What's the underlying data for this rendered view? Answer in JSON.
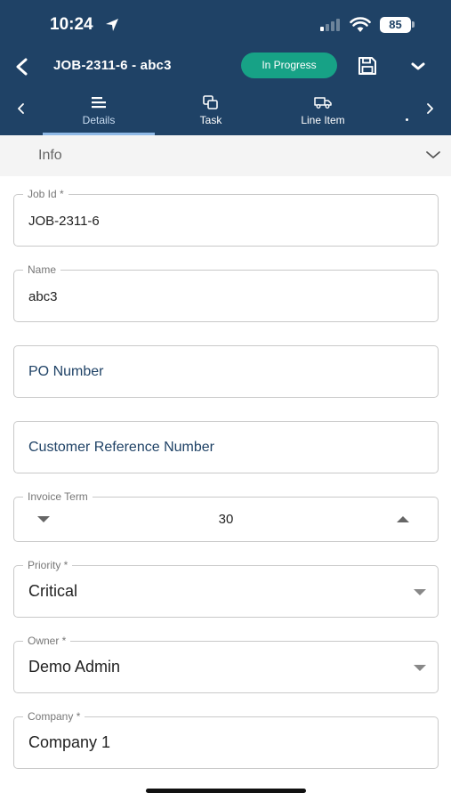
{
  "status_bar": {
    "time": "10:24",
    "battery": "85"
  },
  "header": {
    "job_title": "JOB-2311-6 - abc3",
    "status_badge": "In Progress",
    "status_color": "#17a286",
    "background_color": "#1f4266",
    "icons": {
      "back": "chevron-left-icon",
      "save": "floppy-disk-icon",
      "more": "chevron-down-icon"
    }
  },
  "tabs": [
    {
      "label": "Details",
      "icon": "lines-icon",
      "active": true
    },
    {
      "label": "Task",
      "icon": "copy-icon",
      "active": false
    },
    {
      "label": "Line Item",
      "icon": "truck-icon",
      "active": false
    }
  ],
  "section": {
    "title": "Info"
  },
  "fields": {
    "job_id": {
      "label": "Job Id *",
      "value": "JOB-2311-6"
    },
    "name": {
      "label": "Name",
      "value": "abc3"
    },
    "po_number": {
      "placeholder": "PO Number",
      "value": ""
    },
    "customer_reference": {
      "placeholder": "Customer Reference Number",
      "value": ""
    },
    "invoice_term": {
      "label": "Invoice Term",
      "value": "30"
    },
    "priority": {
      "label": "Priority *",
      "value": "Critical"
    },
    "owner": {
      "label": "Owner *",
      "value": "Demo Admin"
    },
    "company": {
      "label": "Company *",
      "value": "Company 1"
    }
  }
}
